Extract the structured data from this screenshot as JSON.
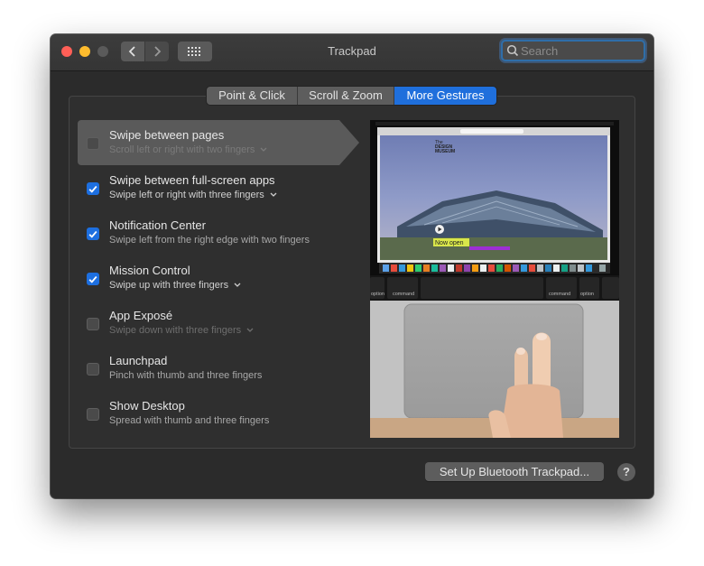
{
  "window": {
    "title": "Trackpad",
    "search_placeholder": "Search"
  },
  "tabs": [
    {
      "label": "Point & Click",
      "selected": false
    },
    {
      "label": "Scroll & Zoom",
      "selected": false
    },
    {
      "label": "More Gestures",
      "selected": true
    }
  ],
  "gestures": [
    {
      "title": "Swipe between pages",
      "subtitle": "Scroll left or right with two fingers",
      "checked": false,
      "has_menu": true
    },
    {
      "title": "Swipe between full-screen apps",
      "subtitle": "Swipe left or right with three fingers",
      "checked": true,
      "has_menu": true
    },
    {
      "title": "Notification Center",
      "subtitle": "Swipe left from the right edge with two fingers",
      "checked": true,
      "has_menu": false
    },
    {
      "title": "Mission Control",
      "subtitle": "Swipe up with three fingers",
      "checked": true,
      "has_menu": true
    },
    {
      "title": "App Exposé",
      "subtitle": "Swipe down with three fingers",
      "checked": false,
      "has_menu": true
    },
    {
      "title": "Launchpad",
      "subtitle": "Pinch with thumb and three fingers",
      "checked": false,
      "has_menu": false
    },
    {
      "title": "Show Desktop",
      "subtitle": "Spread with thumb and three fingers",
      "checked": false,
      "has_menu": false
    }
  ],
  "preview": {
    "site_line1": "The",
    "site_line2": "DESIGN",
    "site_line3": "MUSEUM",
    "banner": "Now open",
    "key_option_left": "option",
    "key_command_left": "command",
    "key_command_right": "command",
    "key_option_right": "option"
  },
  "buttons": {
    "setup_bluetooth": "Set Up Bluetooth Trackpad...",
    "help": "?"
  },
  "colors": {
    "accent": "#1f6fdc",
    "close": "#ff5f57",
    "minimize": "#febc2e"
  }
}
